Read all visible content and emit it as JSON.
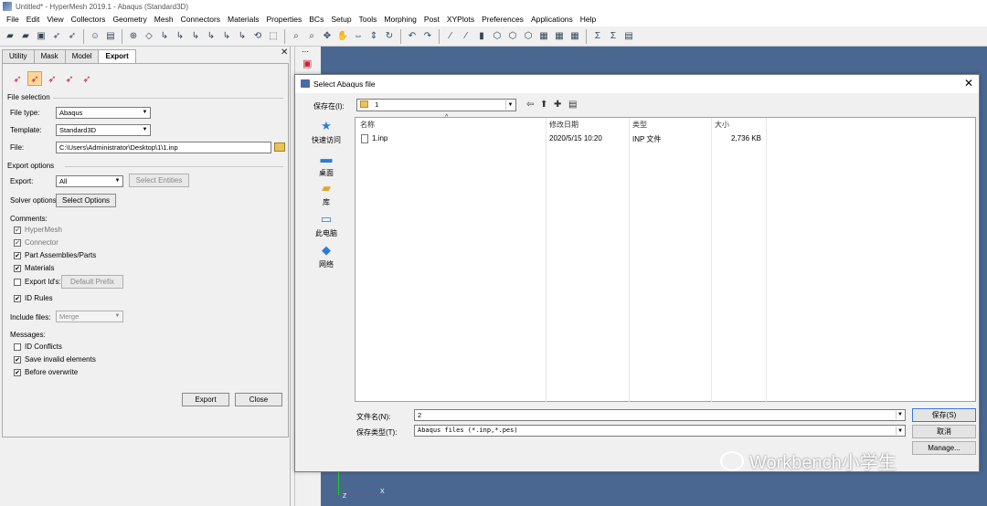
{
  "window": {
    "title": "Untitled* - HyperMesh 2019.1 - Abaqus (Standard3D)"
  },
  "menu": [
    "File",
    "Edit",
    "View",
    "Collectors",
    "Geometry",
    "Mesh",
    "Connectors",
    "Materials",
    "Properties",
    "BCs",
    "Setup",
    "Tools",
    "Morphing",
    "Post",
    "XYPlots",
    "Preferences",
    "Applications",
    "Help"
  ],
  "tabs": [
    "Utility",
    "Mask",
    "Model",
    "Export"
  ],
  "panel": {
    "file_selection": "File selection",
    "file_type_label": "File type:",
    "file_type": "Abaqus",
    "template_label": "Template:",
    "template": "Standard3D",
    "file_label": "File:",
    "file_path": "C:\\Users\\Administrator\\Desktop\\1\\1.inp",
    "export_options": "Export options",
    "export_label": "Export:",
    "export_value": "All",
    "select_entities": "Select Entities",
    "solver_options_label": "Solver options:",
    "select_options": "Select Options",
    "comments_label": "Comments:",
    "hypermesh": "HyperMesh",
    "connector": "Connector",
    "part_assemblies": "Part Assemblies/Parts",
    "materials": "Materials",
    "export_ids": "Export Id's:",
    "default_prefix": "Default Prefix",
    "id_rules": "ID Rules",
    "include_files_label": "Include files:",
    "include_files": "Merge",
    "messages_label": "Messages:",
    "id_conflicts": "ID Conflicts",
    "save_invalid": "Save invalid elements",
    "before_overwrite": "Before overwrite",
    "export_btn": "Export",
    "close_btn": "Close"
  },
  "dialog": {
    "title": "Select Abaqus file",
    "save_in_label": "保存在(I):",
    "save_in_value": "1",
    "places": [
      "快速访问",
      "桌面",
      "库",
      "此电脑",
      "网络"
    ],
    "columns": [
      "名称",
      "修改日期",
      "类型",
      "大小"
    ],
    "files": [
      {
        "name": "1.inp",
        "date": "2020/5/15 10:20",
        "type": "INP 文件",
        "size": "2,736 KB"
      }
    ],
    "filename_label": "文件名(N):",
    "filename_value": "2",
    "filetype_label": "保存类型(T):",
    "filetype_value": "Abaqus files (*.inp,*.pes)",
    "save_btn": "保存(S)",
    "cancel_btn": "取消",
    "manage_btn": "Manage..."
  },
  "axis": {
    "x": "X",
    "z": "Z"
  },
  "watermark": "Workbench小学生"
}
